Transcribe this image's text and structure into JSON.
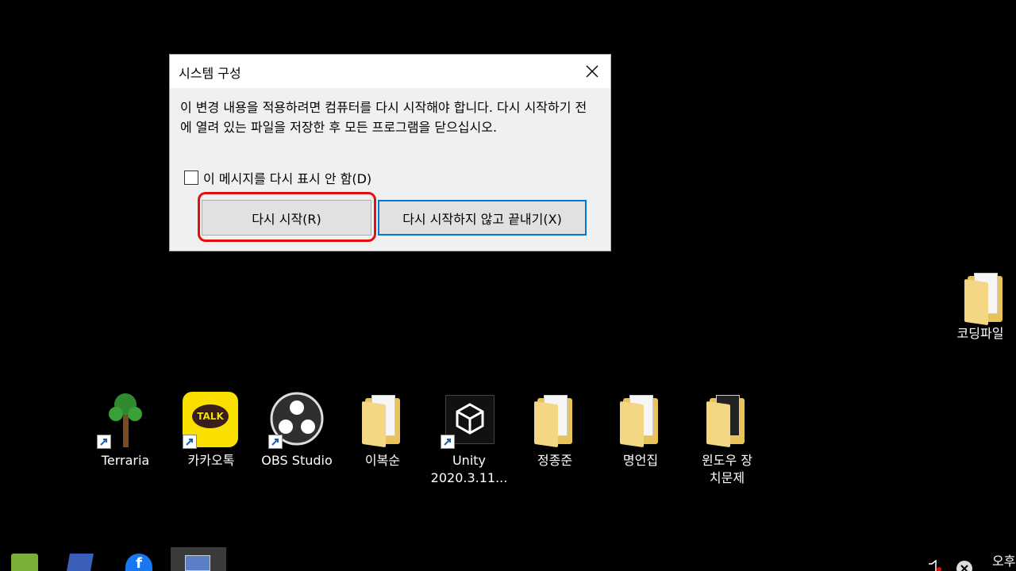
{
  "dialog": {
    "title": "시스템 구성",
    "message": "이 변경 내용을 적용하려면 컴퓨터를 다시 시작해야 합니다. 다시 시작하기 전에 열려 있는 파일을 저장한 후 모든 프로그램을 닫으십시오.",
    "checkbox_label": "이 메시지를 다시 표시 안 함(D)",
    "restart_button": "다시 시작(R)",
    "exit_button": "다시 시작하지 않고 끝내기(X)"
  },
  "desktop": {
    "icons": [
      {
        "label": "Terraria",
        "icon": "terraria-icon"
      },
      {
        "label": "카카오톡",
        "icon": "kakaotalk-icon",
        "badge": "TALK"
      },
      {
        "label": "OBS Studio",
        "icon": "obs-icon"
      },
      {
        "label": "이복순",
        "icon": "folder-icon"
      },
      {
        "label": "Unity 2020.3.11...",
        "icon": "unity-icon"
      },
      {
        "label": "정종준",
        "icon": "folder-icon"
      },
      {
        "label": "명언집",
        "icon": "folder-icon"
      },
      {
        "label": "윈도우 장치문제",
        "icon": "folder-icon"
      },
      {
        "label": "코딩파일",
        "icon": "folder-icon"
      }
    ]
  },
  "taskbar": {
    "clock_partial": "오후"
  },
  "colors": {
    "accent": "#0078d7",
    "highlight": "#e01010",
    "kakao_yellow": "#f9e000"
  }
}
